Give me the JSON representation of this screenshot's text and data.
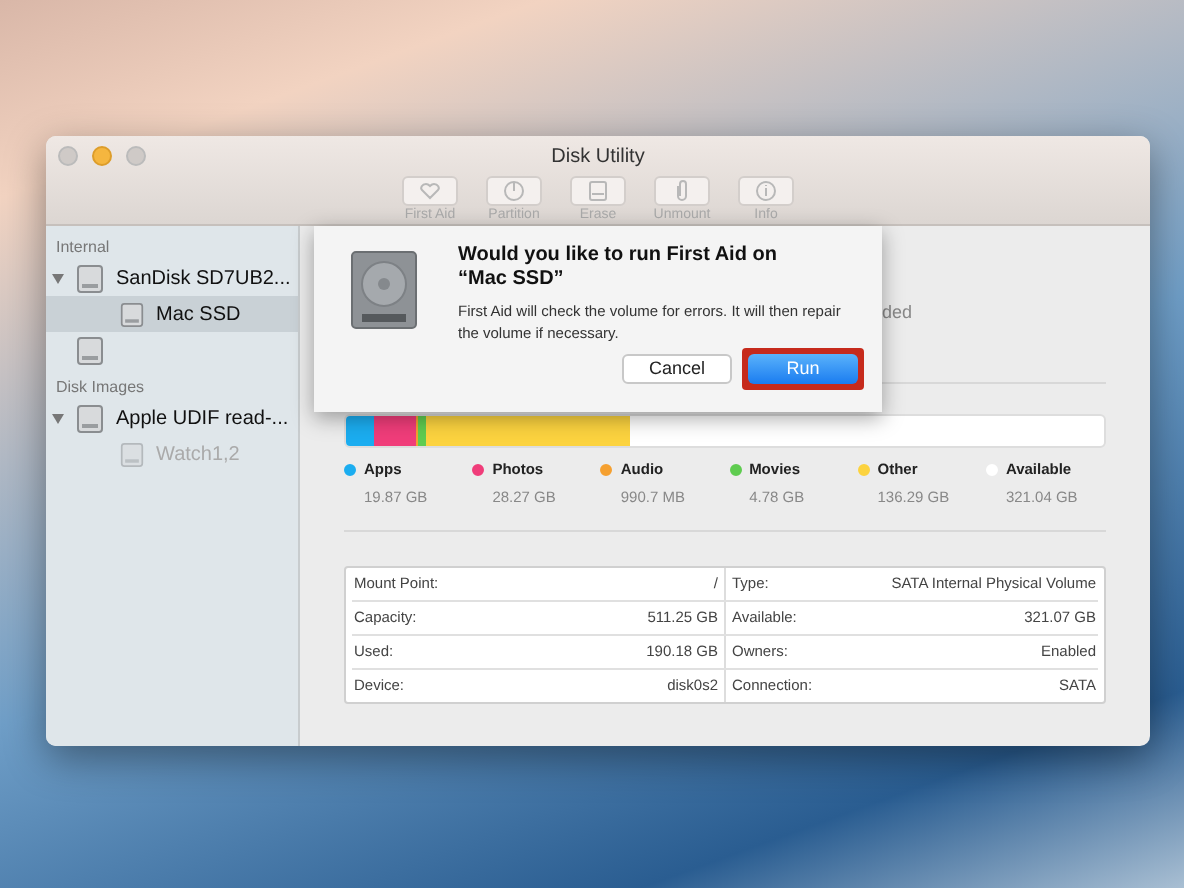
{
  "window": {
    "title": "Disk Utility"
  },
  "toolbar": [
    {
      "label": "First Aid"
    },
    {
      "label": "Partition"
    },
    {
      "label": "Erase"
    },
    {
      "label": "Unmount"
    },
    {
      "label": "Info"
    }
  ],
  "sidebar": {
    "sections": [
      {
        "title": "Internal",
        "items": [
          {
            "label": "SanDisk SD7UB2...",
            "expanded": true,
            "selected": false,
            "disabled": false,
            "children": [
              {
                "label": "Mac SSD",
                "selected": true,
                "disabled": false
              }
            ]
          },
          {
            "selected": false,
            "disabled": false
          }
        ]
      },
      {
        "title": "Disk Images",
        "items": [
          {
            "label": "Apple UDIF read-...",
            "expanded": true,
            "selected": false,
            "disabled": false,
            "children": [
              {
                "label": "Watch1,2",
                "selected": false,
                "disabled": true
              }
            ]
          }
        ]
      }
    ]
  },
  "header_fragment": "ded",
  "usage_bar": [
    {
      "color": "#1badf0",
      "level": 0.037
    },
    {
      "color": "#f03d7a",
      "level": 0.056
    },
    {
      "color": "#f5a030",
      "level": 0.002
    },
    {
      "color": "#5fcc50",
      "level": 0.01
    },
    {
      "color": "#fcd33f",
      "level": 0.27
    }
  ],
  "usage": [
    {
      "name": "Apps",
      "size": "19.87 GB",
      "color": "#1badf0"
    },
    {
      "name": "Photos",
      "size": "28.27 GB",
      "color": "#f03d7a"
    },
    {
      "name": "Audio",
      "size": "990.7 MB",
      "color": "#f5a030"
    },
    {
      "name": "Movies",
      "size": "4.78 GB",
      "color": "#5fcc50"
    },
    {
      "name": "Other",
      "size": "136.29 GB",
      "color": "#fcd33f"
    },
    {
      "name": "Available",
      "size": "321.04 GB",
      "color": "#ffffff"
    }
  ],
  "info": [
    [
      {
        "label": "Mount Point:",
        "value": "/"
      },
      {
        "label": "Type:",
        "value": "SATA Internal Physical Volume"
      }
    ],
    [
      {
        "label": "Capacity:",
        "value": "511.25 GB"
      },
      {
        "label": "Available:",
        "value": "321.07 GB"
      }
    ],
    [
      {
        "label": "Used:",
        "value": "190.18 GB"
      },
      {
        "label": "Owners:",
        "value": "Enabled"
      }
    ],
    [
      {
        "label": "Device:",
        "value": "disk0s2"
      },
      {
        "label": "Connection:",
        "value": "SATA"
      }
    ]
  ],
  "dialog": {
    "title": "Would you like to run First Aid on “Mac SSD”",
    "message": "First Aid will check the volume for errors. It will then repair the volume if necessary.",
    "buttons": [
      {
        "label": "Cancel",
        "kind": "secondary",
        "highlighted": false
      },
      {
        "label": "Run",
        "kind": "primary",
        "highlighted": true
      }
    ]
  }
}
